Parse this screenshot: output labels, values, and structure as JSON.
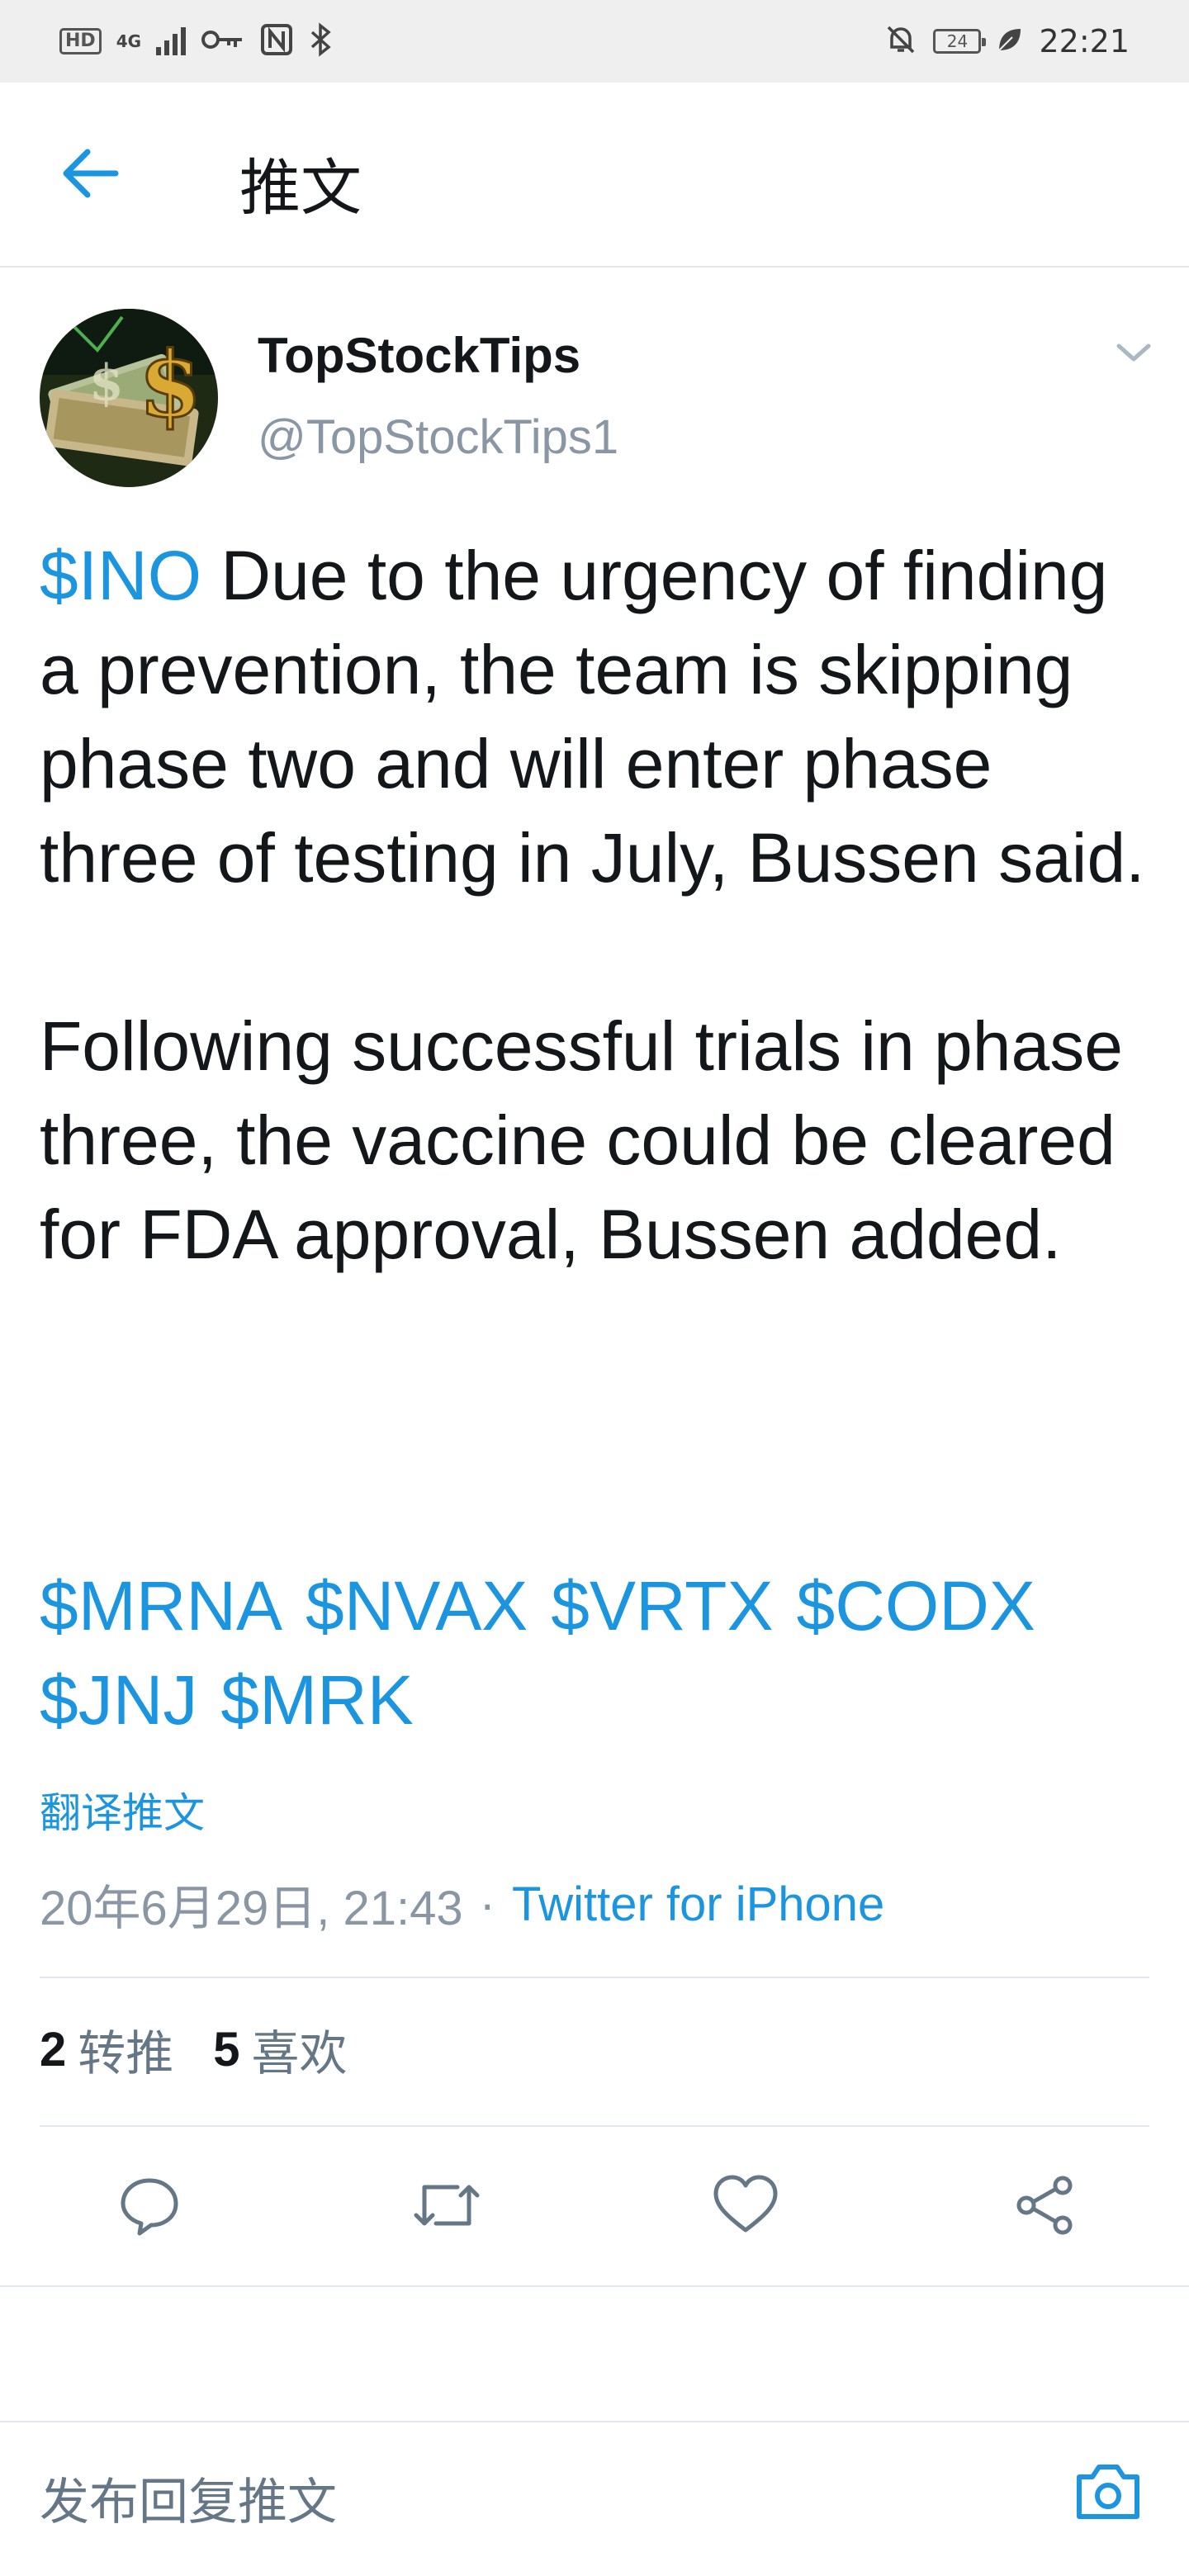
{
  "status_bar": {
    "hd_badge": "HD",
    "network": "4G",
    "time": "22:21",
    "battery": "24",
    "icons": [
      "hd-icon",
      "signal-icon",
      "key-icon",
      "nfc-icon",
      "bluetooth-icon",
      "mute-icon",
      "battery-icon",
      "leaf-icon"
    ]
  },
  "header": {
    "back_icon": "arrow-left-icon",
    "title": "推文"
  },
  "tweet": {
    "author_name": "TopStockTips",
    "author_handle": "@TopStockTips1",
    "lead_cashtag": "$INO",
    "paragraph1": " Due to the urgency of finding a prevention, the team is skipping phase two and will enter phase three of testing in July, Bussen said.",
    "paragraph2": "Following successful trials in phase three, the vaccine could be cleared for FDA approval, Bussen added.",
    "cashtags": [
      "$MRNA",
      "$NVAX",
      "$VRTX",
      "$CODX",
      "$JNJ",
      "$MRK"
    ],
    "translate_label": "翻译推文",
    "timestamp": "20年6月29日, 21:43",
    "separator": "·",
    "source": "Twitter for iPhone"
  },
  "stats": {
    "retweets_count": "2",
    "retweets_label": "转推",
    "likes_count": "5",
    "likes_label": "喜欢"
  },
  "actions": {
    "icons": [
      "reply-icon",
      "retweet-icon",
      "like-icon",
      "share-icon"
    ]
  },
  "reply_bar": {
    "placeholder": "发布回复推文",
    "camera_icon": "camera-icon"
  },
  "colors": {
    "accent": "#1b95e0",
    "text": "#14171a",
    "secondary": "#8a96a3",
    "divider": "#e1e8ed",
    "status_bar_bg": "#efefef"
  }
}
